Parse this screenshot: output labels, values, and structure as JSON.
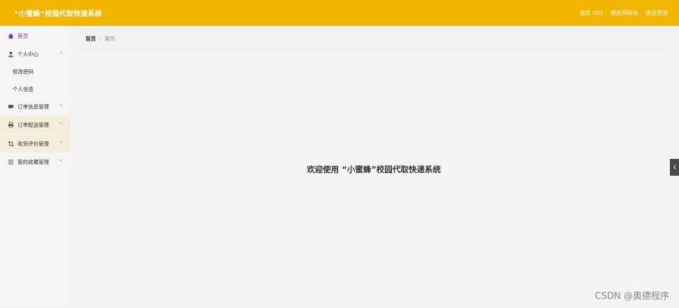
{
  "header": {
    "title": "“小蜜蜂”校园代取快递系统",
    "user": "会员 001",
    "back_to_front": "退出到前台",
    "logout": "退出登录"
  },
  "sidebar": {
    "items": [
      {
        "label": "首页",
        "icon": "home-icon"
      },
      {
        "label": "个人中心",
        "icon": "user-icon"
      },
      {
        "label": "修改密码"
      },
      {
        "label": "个人信息"
      },
      {
        "label": "订单信息管理",
        "icon": "chat-icon"
      },
      {
        "label": "订单配送管理",
        "icon": "printer-icon"
      },
      {
        "label": "收货评价管理",
        "icon": "crop-icon"
      },
      {
        "label": "我的收藏管理",
        "icon": "list-icon"
      }
    ]
  },
  "breadcrumb": {
    "root": "首页",
    "current": "首页"
  },
  "main": {
    "welcome": "欢迎使用 “小蜜蜂”校园代取快递系统"
  },
  "watermark": "CSDN @奥德程序",
  "colors": {
    "header_bg": "#f2b600",
    "highlight_bg": "#f4eddc",
    "active": "#6d2bd6"
  }
}
